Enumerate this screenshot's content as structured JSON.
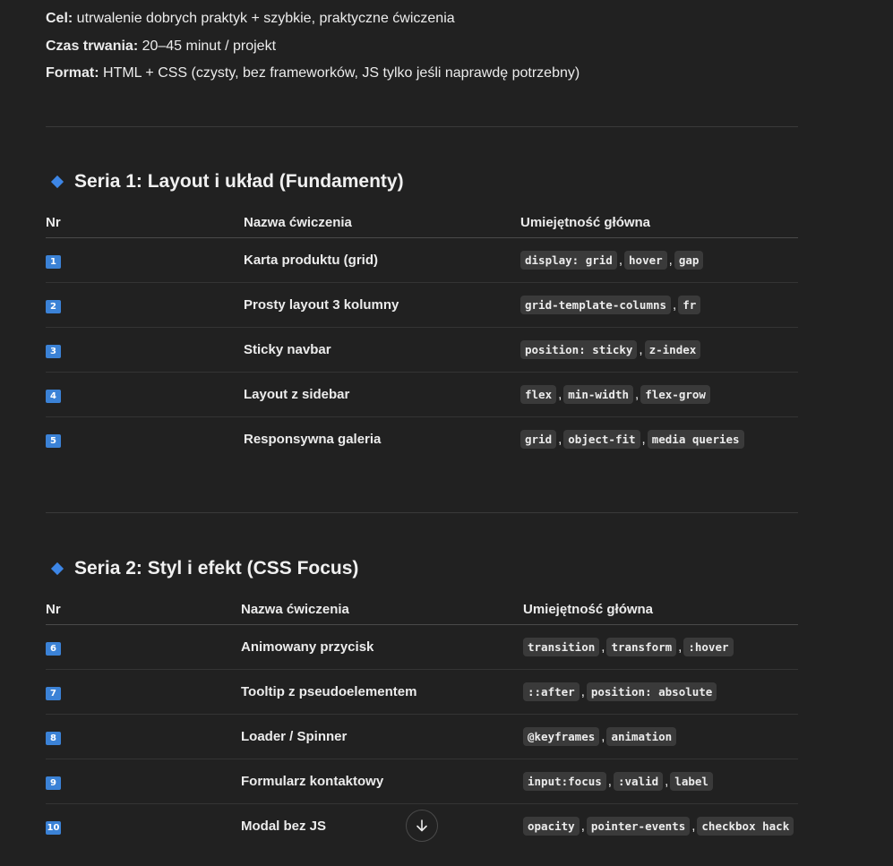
{
  "meta": {
    "goal_label": "Cel:",
    "goal_text": " utrwalenie dobrych praktyk + szybkie, praktyczne ćwiczenia",
    "duration_label": "Czas trwania:",
    "duration_text": " 20–45 minut / projekt",
    "format_label": "Format:",
    "format_text": " HTML + CSS (czysty, bez frameworków, JS tylko jeśli naprawdę potrzebny)"
  },
  "series": [
    {
      "title": "Seria 1: Layout i układ (Fundamenty)",
      "headers": [
        "Nr",
        "Nazwa ćwiczenia",
        "Umiejętność główna"
      ],
      "rows": [
        {
          "nr": "1",
          "name": "Karta produktu (grid)",
          "skills": [
            "display: grid",
            "hover",
            "gap"
          ]
        },
        {
          "nr": "2",
          "name": "Prosty layout 3 kolumny",
          "skills": [
            "grid-template-columns",
            "fr"
          ]
        },
        {
          "nr": "3",
          "name": "Sticky navbar",
          "skills": [
            "position: sticky",
            "z-index"
          ]
        },
        {
          "nr": "4",
          "name": "Layout z sidebar",
          "skills": [
            "flex",
            "min-width",
            "flex-grow"
          ]
        },
        {
          "nr": "5",
          "name": "Responsywna galeria",
          "skills": [
            "grid",
            "object-fit",
            "media queries"
          ]
        }
      ]
    },
    {
      "title": "Seria 2: Styl i efekt (CSS Focus)",
      "headers": [
        "Nr",
        "Nazwa ćwiczenia",
        "Umiejętność główna"
      ],
      "rows": [
        {
          "nr": "6",
          "name": "Animowany przycisk",
          "skills": [
            "transition",
            "transform",
            ":hover"
          ]
        },
        {
          "nr": "7",
          "name": "Tooltip z pseudoelementem",
          "skills": [
            "::after",
            "position: absolute"
          ]
        },
        {
          "nr": "8",
          "name": "Loader / Spinner",
          "skills": [
            "@keyframes",
            "animation"
          ]
        },
        {
          "nr": "9",
          "name": "Formularz kontaktowy",
          "skills": [
            "input:focus",
            ":valid",
            "label"
          ]
        },
        {
          "nr": "10",
          "name": "Modal bez JS",
          "skills": [
            "opacity",
            "pointer-events",
            "checkbox hack"
          ]
        }
      ]
    }
  ],
  "icons": {
    "series_marker": "blue-diamond-icon",
    "scroll": "arrow-down-icon"
  },
  "colors": {
    "background": "#212121",
    "accent": "#3b82d6"
  }
}
